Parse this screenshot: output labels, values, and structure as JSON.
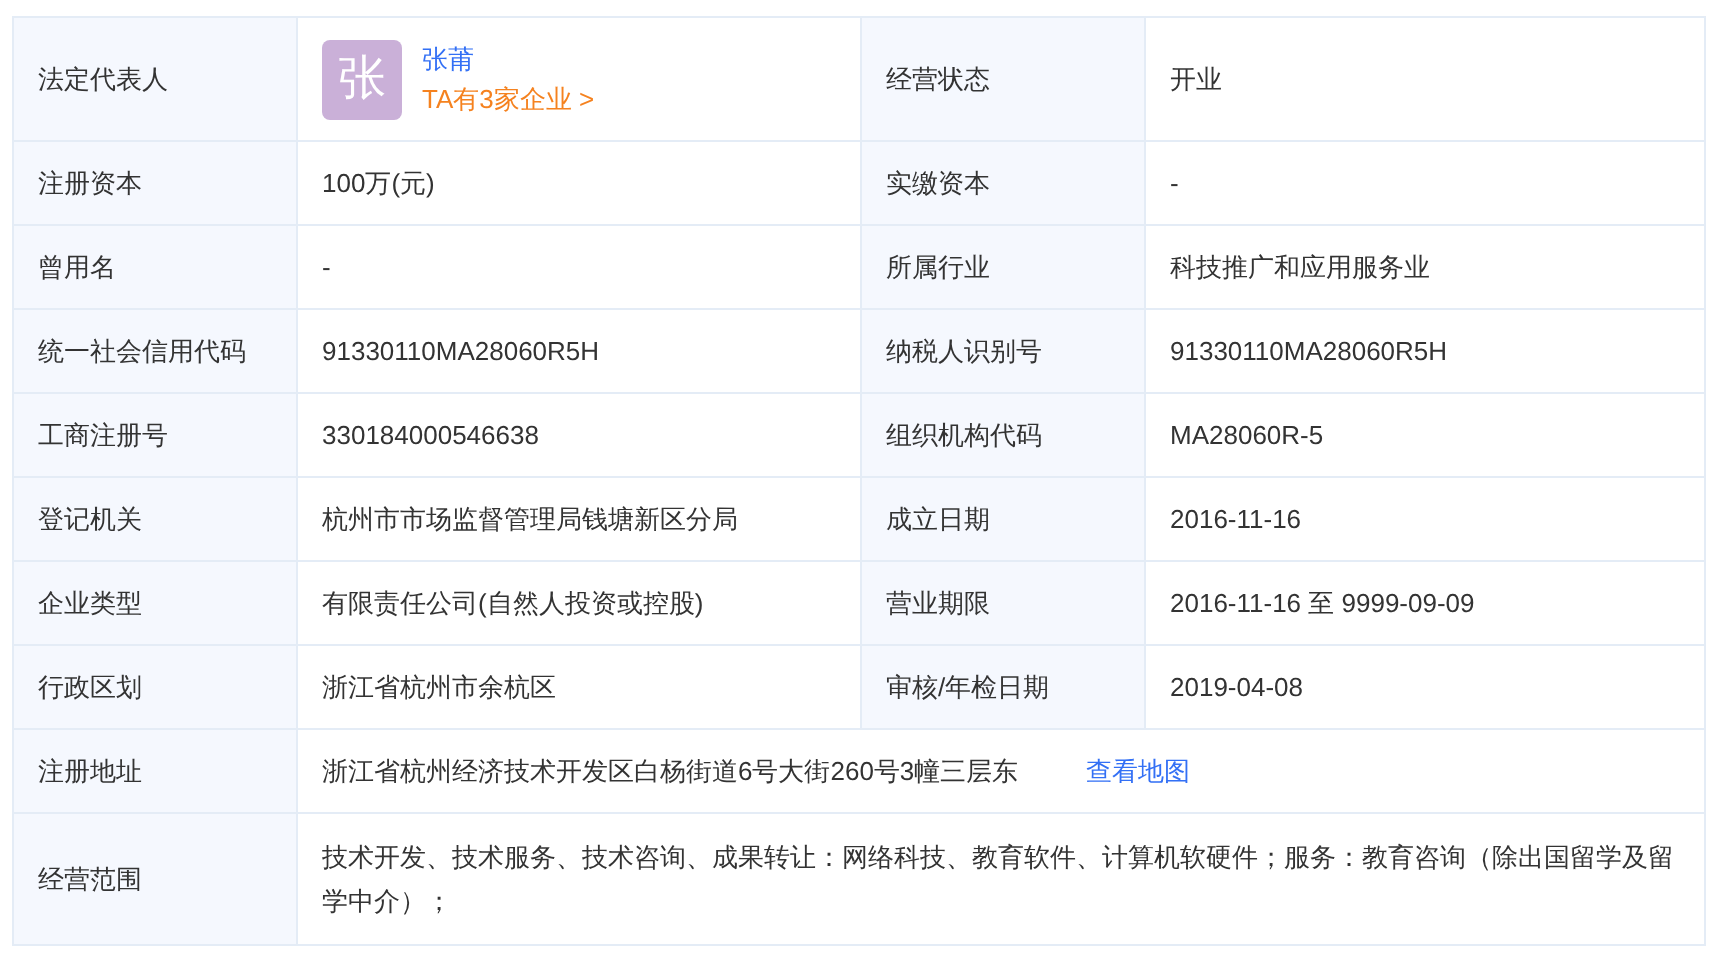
{
  "rows": [
    {
      "fields": [
        {
          "label": "法定代表人",
          "kind": "person",
          "avatar": "张",
          "name": "张莆",
          "link": "TA有3家企业 >"
        },
        {
          "label": "经营状态",
          "kind": "text",
          "value": "开业"
        }
      ]
    },
    {
      "fields": [
        {
          "label": "注册资本",
          "kind": "text",
          "value": "100万(元)"
        },
        {
          "label": "实缴资本",
          "kind": "text",
          "value": "-"
        }
      ]
    },
    {
      "fields": [
        {
          "label": "曾用名",
          "kind": "text",
          "value": "-"
        },
        {
          "label": "所属行业",
          "kind": "text",
          "value": "科技推广和应用服务业"
        }
      ]
    },
    {
      "fields": [
        {
          "label": "统一社会信用代码",
          "kind": "text",
          "value": "91330110MA28060R5H"
        },
        {
          "label": "纳税人识别号",
          "kind": "text",
          "value": "91330110MA28060R5H"
        }
      ]
    },
    {
      "fields": [
        {
          "label": "工商注册号",
          "kind": "text",
          "value": "330184000546638"
        },
        {
          "label": "组织机构代码",
          "kind": "text",
          "value": "MA28060R-5"
        }
      ]
    },
    {
      "fields": [
        {
          "label": "登记机关",
          "kind": "text",
          "value": "杭州市市场监督管理局钱塘新区分局"
        },
        {
          "label": "成立日期",
          "kind": "text",
          "value": "2016-11-16"
        }
      ]
    },
    {
      "fields": [
        {
          "label": "企业类型",
          "kind": "text",
          "value": "有限责任公司(自然人投资或控股)"
        },
        {
          "label": "营业期限",
          "kind": "text",
          "value": "2016-11-16 至 9999-09-09"
        }
      ]
    },
    {
      "fields": [
        {
          "label": "行政区划",
          "kind": "text",
          "value": "浙江省杭州市余杭区"
        },
        {
          "label": "审核/年检日期",
          "kind": "text",
          "value": "2019-04-08"
        }
      ]
    },
    {
      "fields": [
        {
          "label": "注册地址",
          "kind": "address",
          "value": "浙江省杭州经济技术开发区白杨街道6号大街260号3幢三层东",
          "link": "查看地图"
        }
      ]
    },
    {
      "fields": [
        {
          "label": "经营范围",
          "kind": "text",
          "value": "技术开发、技术服务、技术咨询、成果转让：网络科技、教育软件、计算机软硬件；服务：教育咨询（除出国留学及留学中介）；"
        }
      ]
    }
  ]
}
